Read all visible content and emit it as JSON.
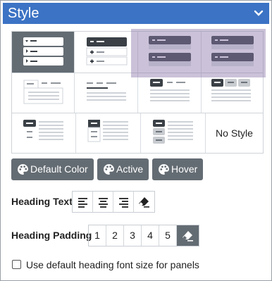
{
  "panel": {
    "title": "Style"
  },
  "style_options": {
    "no_style_label": "No Style"
  },
  "color_buttons": [
    {
      "label": "Default Color"
    },
    {
      "label": "Active"
    },
    {
      "label": "Hover"
    }
  ],
  "heading_text": {
    "label": "Heading Text",
    "options": [
      "align-left",
      "align-center",
      "align-right",
      "clear"
    ]
  },
  "heading_padding": {
    "label": "Heading Padding",
    "options": [
      "1",
      "2",
      "3",
      "4",
      "5"
    ],
    "selected": "clear"
  },
  "checkbox": {
    "label": "Use default heading font size for panels",
    "checked": false
  },
  "colors": {
    "header": "#3c73c4",
    "button": "#646c73",
    "selected_tile": "#646c73",
    "highlight": "#8c78aa"
  }
}
